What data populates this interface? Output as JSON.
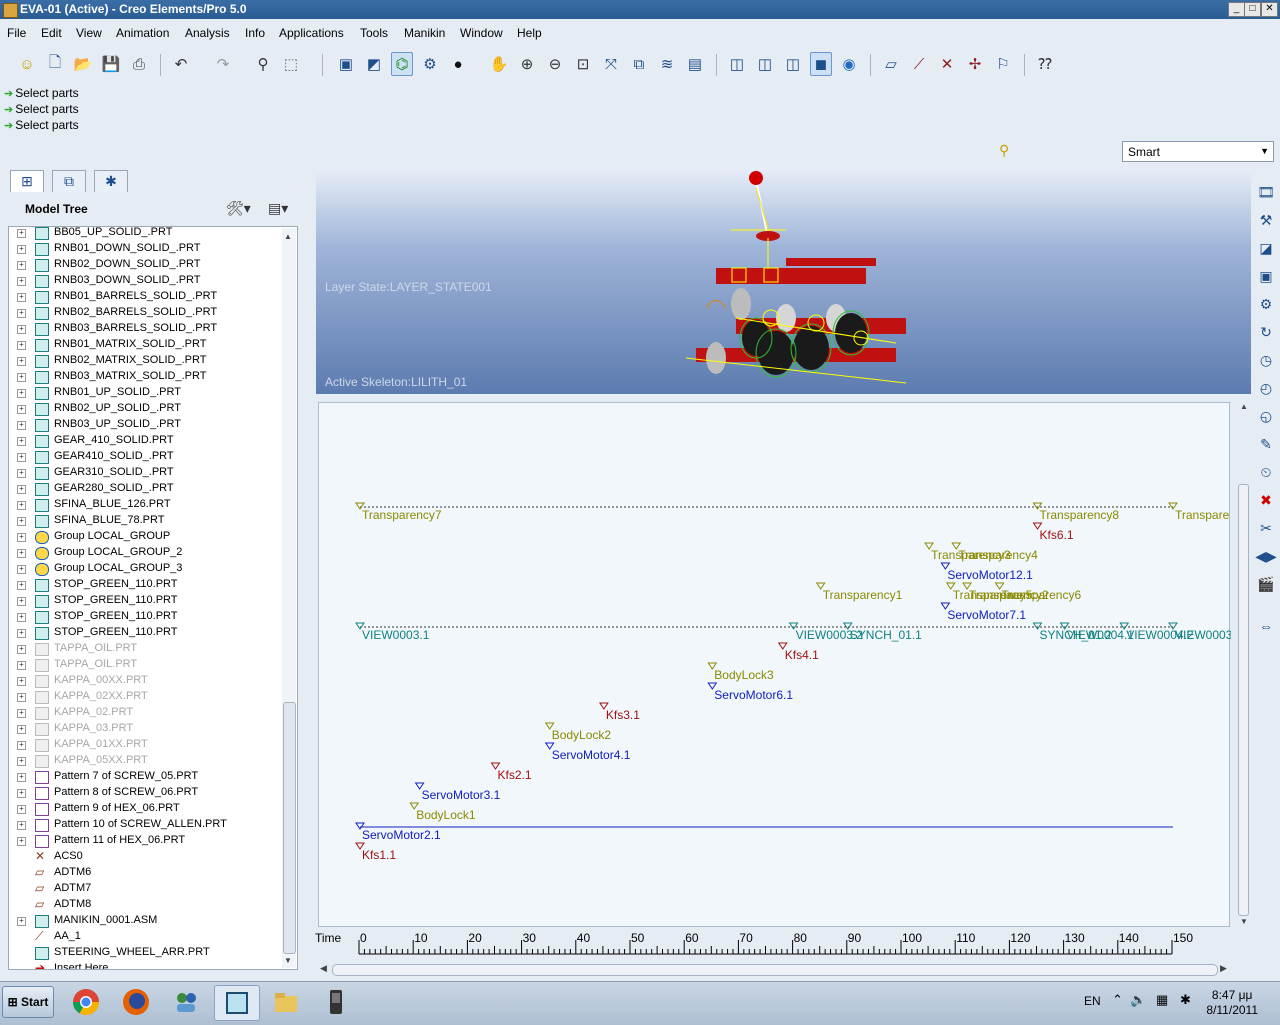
{
  "window": {
    "title": "EVA-01 (Active) - Creo Elements/Pro 5.0"
  },
  "menu": [
    "File",
    "Edit",
    "View",
    "Animation",
    "Analysis",
    "Info",
    "Applications",
    "Tools",
    "Manikin",
    "Window",
    "Help"
  ],
  "messages": [
    "Select parts",
    "Select parts",
    "Select parts"
  ],
  "filter_select": {
    "value": "Smart"
  },
  "model_tree": {
    "title": "Model Tree",
    "items": [
      {
        "label": "BB05_UP_SOLID_.PRT",
        "icon": "part-icon",
        "state": "normal"
      },
      {
        "label": "RNB01_DOWN_SOLID_.PRT",
        "icon": "part-icon",
        "state": "normal"
      },
      {
        "label": "RNB02_DOWN_SOLID_.PRT",
        "icon": "part-icon",
        "state": "normal"
      },
      {
        "label": "RNB03_DOWN_SOLID_.PRT",
        "icon": "part-icon",
        "state": "normal"
      },
      {
        "label": "RNB01_BARRELS_SOLID_.PRT",
        "icon": "part-icon",
        "state": "normal"
      },
      {
        "label": "RNB02_BARRELS_SOLID_.PRT",
        "icon": "part-icon",
        "state": "normal"
      },
      {
        "label": "RNB03_BARRELS_SOLID_.PRT",
        "icon": "part-icon",
        "state": "normal"
      },
      {
        "label": "RNB01_MATRIX_SOLID_.PRT",
        "icon": "part-icon",
        "state": "normal"
      },
      {
        "label": "RNB02_MATRIX_SOLID_.PRT",
        "icon": "part-icon",
        "state": "normal"
      },
      {
        "label": "RNB03_MATRIX_SOLID_.PRT",
        "icon": "part-icon",
        "state": "normal"
      },
      {
        "label": "RNB01_UP_SOLID_.PRT",
        "icon": "part-icon",
        "state": "normal"
      },
      {
        "label": "RNB02_UP_SOLID_.PRT",
        "icon": "part-icon",
        "state": "normal"
      },
      {
        "label": "RNB03_UP_SOLID_.PRT",
        "icon": "part-icon",
        "state": "normal"
      },
      {
        "label": "GEAR_410_SOLID.PRT",
        "icon": "part-icon",
        "state": "normal"
      },
      {
        "label": "GEAR410_SOLID_.PRT",
        "icon": "part-icon",
        "state": "normal"
      },
      {
        "label": "GEAR310_SOLID_.PRT",
        "icon": "part-icon",
        "state": "normal"
      },
      {
        "label": "GEAR280_SOLID_.PRT",
        "icon": "part-icon",
        "state": "normal"
      },
      {
        "label": "SFINA_BLUE_126.PRT",
        "icon": "part-icon",
        "state": "normal"
      },
      {
        "label": "SFINA_BLUE_78.PRT",
        "icon": "part-icon",
        "state": "normal"
      },
      {
        "label": "Group LOCAL_GROUP",
        "icon": "group-icon",
        "state": "normal"
      },
      {
        "label": "Group LOCAL_GROUP_2",
        "icon": "group-icon",
        "state": "normal"
      },
      {
        "label": "Group LOCAL_GROUP_3",
        "icon": "group-icon",
        "state": "normal"
      },
      {
        "label": "STOP_GREEN_110.PRT",
        "icon": "part-icon",
        "state": "normal"
      },
      {
        "label": "STOP_GREEN_110.PRT",
        "icon": "part-icon",
        "state": "normal"
      },
      {
        "label": "STOP_GREEN_110.PRT",
        "icon": "part-icon",
        "state": "normal"
      },
      {
        "label": "STOP_GREEN_110.PRT",
        "icon": "part-icon",
        "state": "normal"
      },
      {
        "label": "TAPPA_OIL.PRT",
        "icon": "part-icon",
        "state": "dim"
      },
      {
        "label": "TAPPA_OIL.PRT",
        "icon": "part-icon",
        "state": "dim"
      },
      {
        "label": "KAPPA_00XX.PRT",
        "icon": "part-icon",
        "state": "dim"
      },
      {
        "label": "KAPPA_02XX.PRT",
        "icon": "part-icon",
        "state": "dim"
      },
      {
        "label": "KAPPA_02.PRT",
        "icon": "part-icon",
        "state": "dim"
      },
      {
        "label": "KAPPA_03.PRT",
        "icon": "part-icon",
        "state": "dim"
      },
      {
        "label": "KAPPA_01XX.PRT",
        "icon": "part-icon",
        "state": "dim"
      },
      {
        "label": "KAPPA_05XX.PRT",
        "icon": "part-icon",
        "state": "dim"
      },
      {
        "label": "Pattern 7 of SCREW_05.PRT",
        "icon": "pattern-icon",
        "state": "normal"
      },
      {
        "label": "Pattern 8 of SCREW_06.PRT",
        "icon": "pattern-icon",
        "state": "normal"
      },
      {
        "label": "Pattern 9 of HEX_06.PRT",
        "icon": "pattern-icon",
        "state": "normal"
      },
      {
        "label": "Pattern 10 of SCREW_ALLEN.PRT",
        "icon": "pattern-icon",
        "state": "normal"
      },
      {
        "label": "Pattern 11 of HEX_06.PRT",
        "icon": "pattern-icon",
        "state": "normal"
      },
      {
        "label": "ACS0",
        "icon": "csys-icon",
        "state": "leaf"
      },
      {
        "label": "ADTM6",
        "icon": "datum-plane-icon",
        "state": "leaf"
      },
      {
        "label": "ADTM7",
        "icon": "datum-plane-icon",
        "state": "leaf"
      },
      {
        "label": "ADTM8",
        "icon": "datum-plane-icon",
        "state": "leaf"
      },
      {
        "label": "MANIKIN_0001.ASM",
        "icon": "assembly-icon",
        "state": "normal"
      },
      {
        "label": "AA_1",
        "icon": "axis-icon",
        "state": "leaf"
      },
      {
        "label": "STEERING_WHEEL_ARR.PRT",
        "icon": "part-icon",
        "state": "leaf"
      },
      {
        "label": "Insert Here",
        "icon": "insert-arrow-icon",
        "state": "leaf"
      }
    ]
  },
  "viewport": {
    "layer_state": "Layer State:LAYER_STATE001",
    "active_skeleton": "Active Skeleton:LILITH_01"
  },
  "timeline": {
    "axis_label": "Time",
    "axis_min": 0,
    "axis_max": 150,
    "ticks": [
      0,
      10,
      20,
      30,
      40,
      50,
      60,
      70,
      80,
      90,
      100,
      110,
      120,
      130,
      140,
      150
    ],
    "events": [
      {
        "label": "Transparency7",
        "t": 0,
        "color": "#8a8a00",
        "lane": 1
      },
      {
        "label": "Transparency8",
        "t": 125,
        "color": "#8a8a00",
        "lane": 1
      },
      {
        "label": "Transpare",
        "t": 150,
        "color": "#8a8a00",
        "lane": 1
      },
      {
        "label": "Kfs6.1",
        "t": 125,
        "color": "#a01010",
        "lane": 2
      },
      {
        "label": "Transparency3",
        "t": 105,
        "color": "#8a8a00",
        "lane": 3
      },
      {
        "label": "Transparency4",
        "t": 110,
        "color": "#8a8a00",
        "lane": 3
      },
      {
        "label": "ServoMotor12.1",
        "t": 108,
        "color": "#1020c0",
        "lane": 4
      },
      {
        "label": "Transparency1",
        "t": 85,
        "color": "#8a8a00",
        "lane": 5
      },
      {
        "label": "Transparency5",
        "t": 109,
        "color": "#8a8a00",
        "lane": 5
      },
      {
        "label": "Transparency2",
        "t": 112,
        "color": "#8a8a00",
        "lane": 5
      },
      {
        "label": "Transparency6",
        "t": 118,
        "color": "#8a8a00",
        "lane": 5
      },
      {
        "label": "ServoMotor7.1",
        "t": 108,
        "color": "#1020c0",
        "lane": 6
      },
      {
        "label": "VIEW0003.1",
        "t": 0,
        "color": "#108080",
        "lane": 7
      },
      {
        "label": "VIEW0003.2",
        "t": 80,
        "color": "#108080",
        "lane": 7
      },
      {
        "label": "SYNCH_01.1",
        "t": 90,
        "color": "#108080",
        "lane": 7
      },
      {
        "label": "SYNCH_01.2",
        "t": 125,
        "color": "#108080",
        "lane": 7
      },
      {
        "label": "VIEW0004.1",
        "t": 130,
        "color": "#108080",
        "lane": 7
      },
      {
        "label": "VIEW0004.2",
        "t": 141,
        "color": "#108080",
        "lane": 7
      },
      {
        "label": "VIEW0003.3",
        "t": 150,
        "color": "#108080",
        "lane": 7
      },
      {
        "label": "Kfs4.1",
        "t": 78,
        "color": "#a01010",
        "lane": 8
      },
      {
        "label": "BodyLock3",
        "t": 65,
        "color": "#8a8a00",
        "lane": 9
      },
      {
        "label": "ServoMotor6.1",
        "t": 65,
        "color": "#1020c0",
        "lane": 10
      },
      {
        "label": "Kfs3.1",
        "t": 45,
        "color": "#a01010",
        "lane": 11
      },
      {
        "label": "BodyLock2",
        "t": 35,
        "color": "#8a8a00",
        "lane": 12
      },
      {
        "label": "ServoMotor4.1",
        "t": 35,
        "color": "#1020c0",
        "lane": 13
      },
      {
        "label": "Kfs2.1",
        "t": 25,
        "color": "#a01010",
        "lane": 14
      },
      {
        "label": "ServoMotor3.1",
        "t": 11,
        "color": "#1020c0",
        "lane": 15
      },
      {
        "label": "BodyLock1",
        "t": 10,
        "color": "#8a8a00",
        "lane": 16
      },
      {
        "label": "ServoMotor2.1",
        "t": 0,
        "color": "#1020c0",
        "lane": 17
      },
      {
        "label": "Kfs1.1",
        "t": 0,
        "color": "#a01010",
        "lane": 18
      }
    ]
  },
  "taskbar": {
    "start_label": "Start",
    "language": "EN",
    "time": "8:47 μμ",
    "date": "8/11/2011"
  }
}
